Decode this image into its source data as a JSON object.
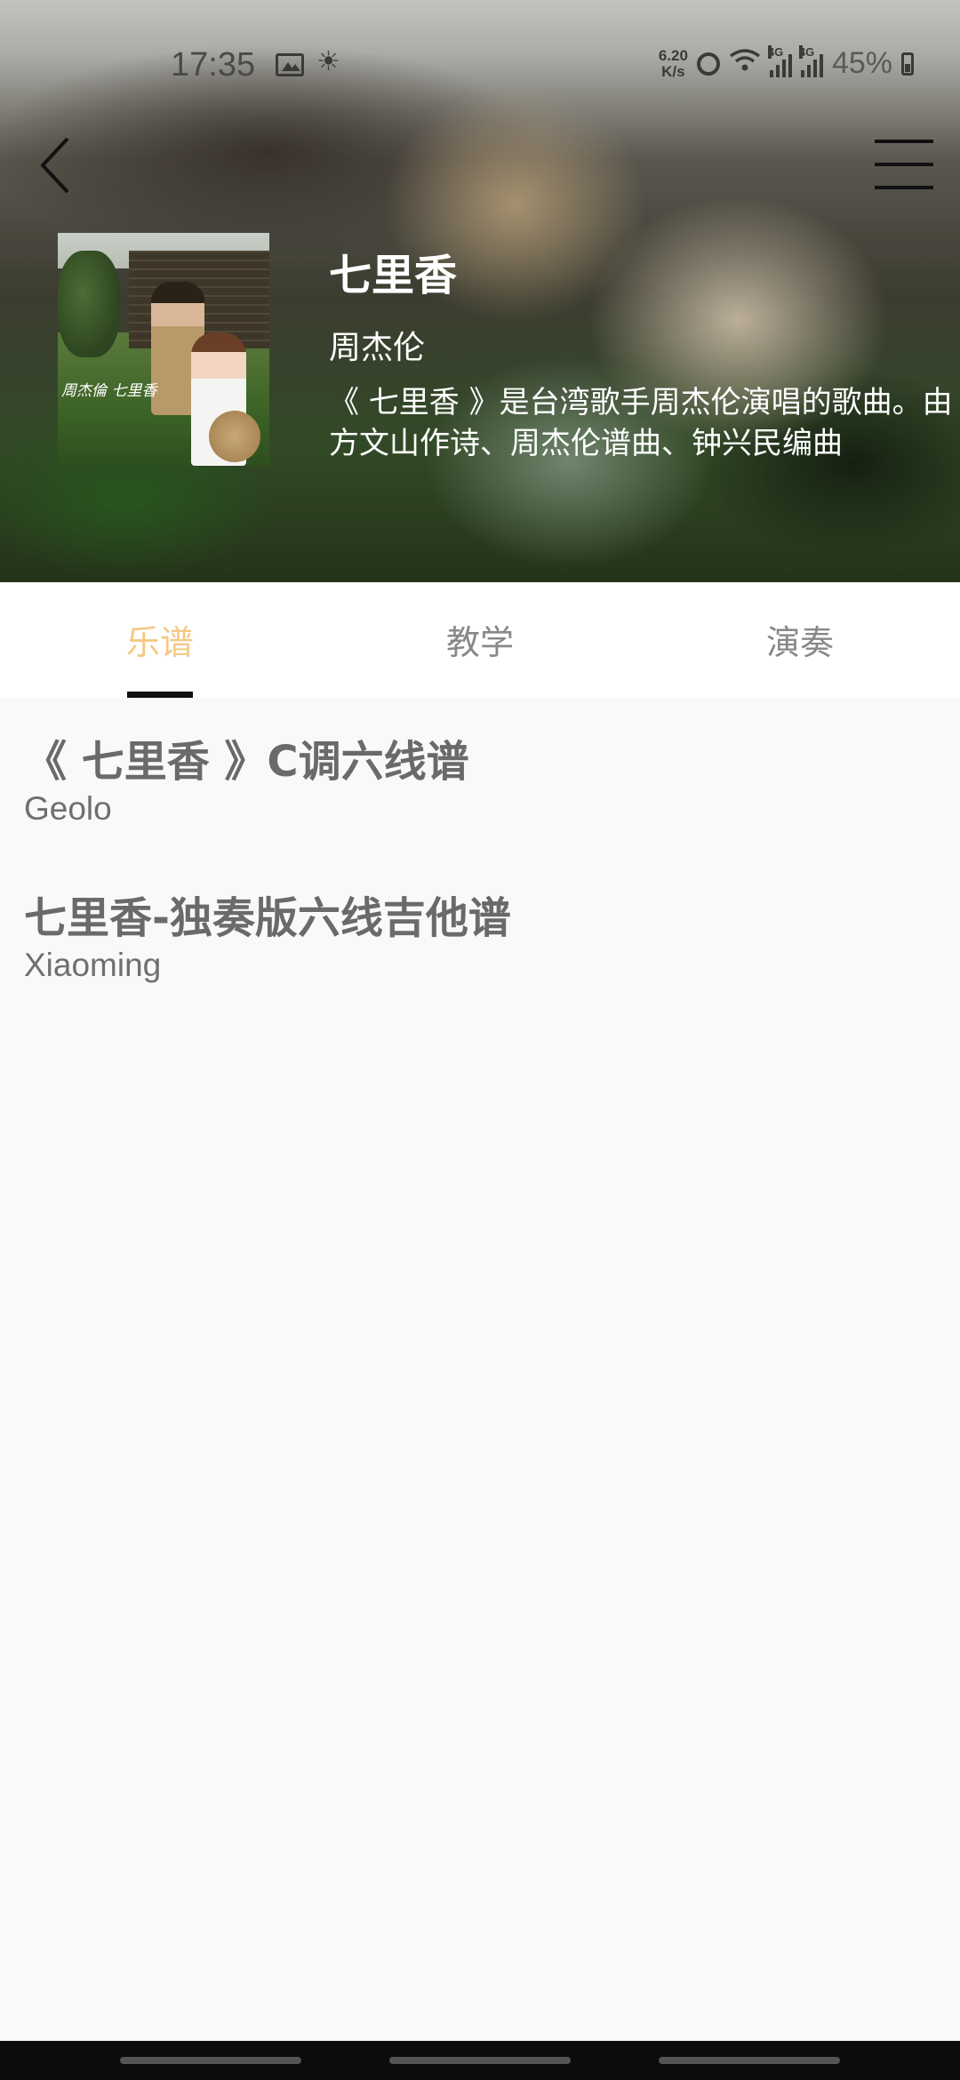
{
  "status_bar": {
    "time": "17:35",
    "net_speed_value": "6.20",
    "net_speed_unit": "K/s",
    "network_1": "4G",
    "network_2": "4G",
    "battery": "45%"
  },
  "header": {
    "title": "七里香",
    "artist": "周杰伦",
    "description": "《 七里香 》是台湾歌手周杰伦演唱的歌曲。由方文山作诗、周杰伦谱曲、钟兴民编曲",
    "cover_text": "周杰倫 七里香"
  },
  "tabs": [
    {
      "label": "乐谱",
      "active": true
    },
    {
      "label": "教学",
      "active": false
    },
    {
      "label": "演奏",
      "active": false
    }
  ],
  "items": [
    {
      "title": "《 七里香 》C调六线谱",
      "author": "Geolo"
    },
    {
      "title": "七里香-独奏版六线吉他谱",
      "author": "Xiaoming"
    }
  ],
  "colors": {
    "tab_active": "#f4c986",
    "tab_inactive": "#888888",
    "indicator": "#111111"
  },
  "icons": [
    "back-icon",
    "menu-icon",
    "image-icon",
    "weather-icon",
    "alarm-icon",
    "wifi-icon",
    "signal-icon",
    "battery-icon"
  ]
}
